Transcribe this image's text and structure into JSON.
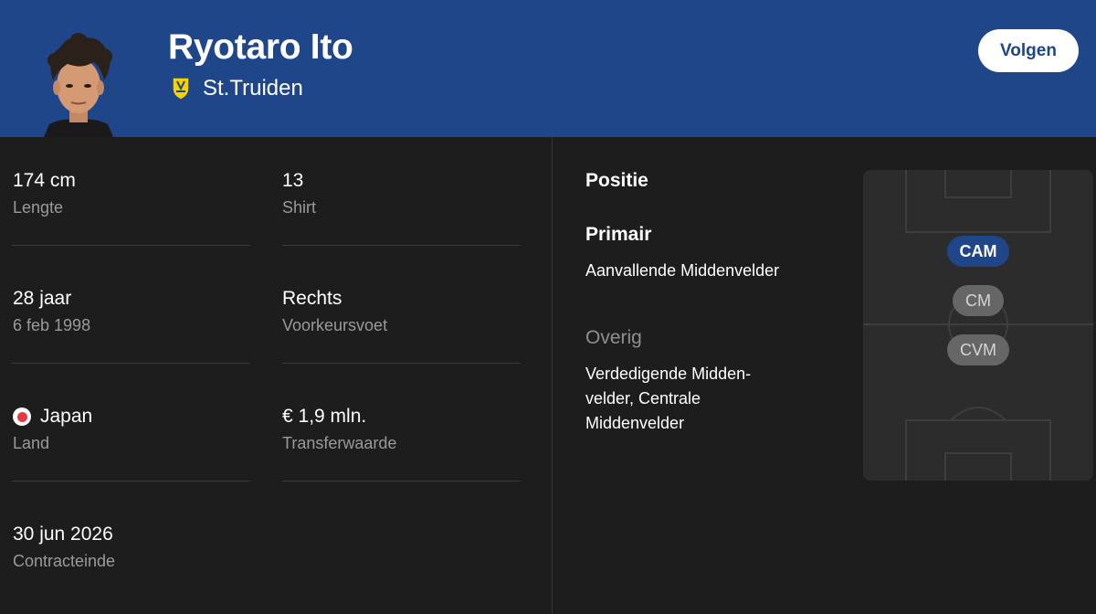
{
  "player": {
    "name": "Ryotaro Ito",
    "club": "St.Truiden",
    "follow_label": "Volgen"
  },
  "stats": {
    "height": {
      "value": "174 cm",
      "label": "Lengte"
    },
    "shirt": {
      "value": "13",
      "label": "Shirt"
    },
    "age": {
      "value": "28 jaar",
      "label": "6 feb 1998"
    },
    "foot": {
      "value": "Rechts",
      "label": "Voorkeursvoet"
    },
    "country": {
      "value": "Japan",
      "label": "Land"
    },
    "transfer": {
      "value": "€ 1,9 mln.",
      "label": "Transferwaarde"
    },
    "contract": {
      "value": "30 jun 2026",
      "label": "Contracteinde"
    }
  },
  "position": {
    "title": "Positie",
    "primary_title": "Primair",
    "primary_text": "Aanvallende Middenvelder",
    "other_title": "Overig",
    "other_text": "Verdedigende Midden-velder, Centrale Middenvelder",
    "pitch_labels": {
      "primary": "CAM",
      "other1": "CM",
      "other2": "CVM"
    }
  },
  "colors": {
    "header_bg": "#1f4689",
    "page_bg": "#1d1d1d",
    "accent": "#1f4689",
    "flag_red": "#e63946"
  },
  "icons": {
    "club_badge": "st-truiden-badge-icon",
    "country_flag": "japan-flag-icon"
  }
}
